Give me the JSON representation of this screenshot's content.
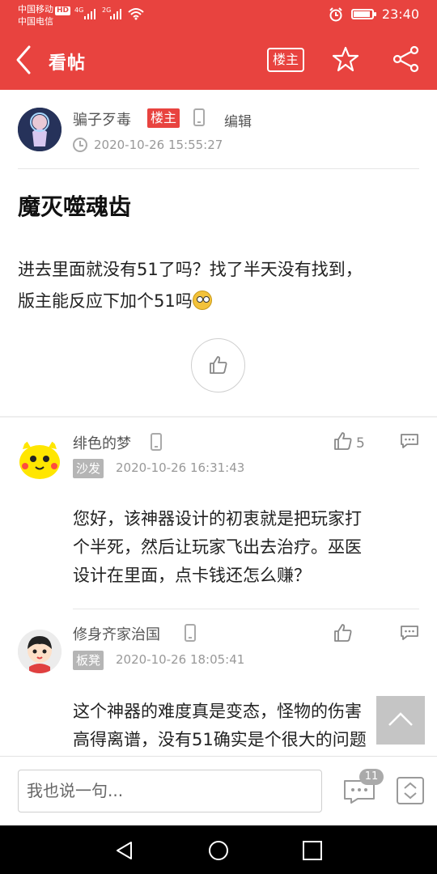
{
  "status_bar": {
    "carrier_1": "中国移动",
    "hd": "HD",
    "carrier_2": "中国电信",
    "signal_1": "4G",
    "signal_2": "2G",
    "time": "23:40",
    "battery_level": 0.85
  },
  "header": {
    "title": "看帖",
    "owner_button": "楼主",
    "icons": [
      "back-icon",
      "star-icon",
      "share-icon"
    ]
  },
  "post": {
    "author": "骗子歹毒",
    "owner_tag": "楼主",
    "edit_label": "编辑",
    "time": "2020-10-26 15:55:27",
    "title": "魔灭噬魂齿",
    "body_line1": "进去里面就没有51了吗？找了半天没有找到，",
    "body_line2": "版主能反应下加个51吗"
  },
  "comments": [
    {
      "author": "绯色的梦",
      "floor": "沙发",
      "time": "2020-10-26 16:31:43",
      "likes": "5",
      "body_lines": [
        "您好，该神器设计的初衷就是把玩家打",
        "个半死，然后让玩家飞出去治疗。巫医",
        "设计在里面，点卡钱还怎么赚？"
      ]
    },
    {
      "author": "修身齐家治国",
      "floor": "板凳",
      "time": "2020-10-26 18:05:41",
      "likes": "",
      "body_lines": [
        "这个神器的难度真是变态，怪物的伤害",
        "高得离谱，没有51确实是个很大的问题"
      ]
    }
  ],
  "bottom_bar": {
    "input_placeholder": "我也说一句...",
    "comment_count": "11"
  },
  "colors": {
    "brand": "#e8433f",
    "tag_grey": "#b5b5b5"
  }
}
